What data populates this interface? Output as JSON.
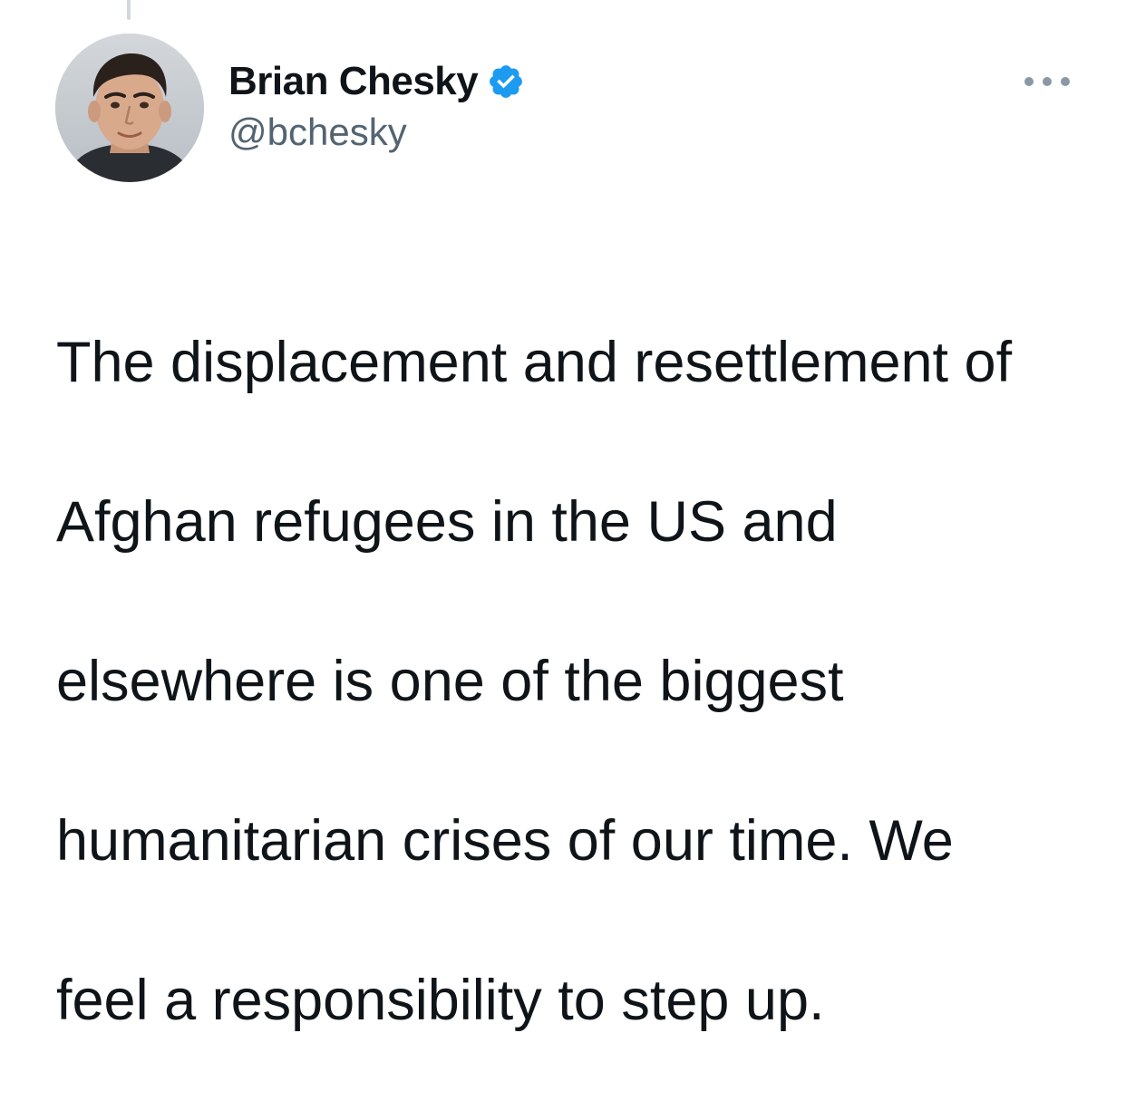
{
  "author": {
    "display_name": "Brian Chesky",
    "handle": "@bchesky",
    "verified": true,
    "avatar_icon": "profile-photo"
  },
  "tweet": {
    "lines": [
      "The displacement and resettlement of",
      "Afghan refugees in the US and",
      "elsewhere is one of the biggest",
      "humanitarian crises of our time. We",
      "feel a responsibility to step up."
    ]
  },
  "icons": {
    "verified": "verified-badge-icon",
    "more": "more-options-icon"
  },
  "colors": {
    "verified_blue": "#1d9bf0",
    "handle_gray": "#536471",
    "text": "#0f1419",
    "more_dots": "#8b98a5"
  }
}
